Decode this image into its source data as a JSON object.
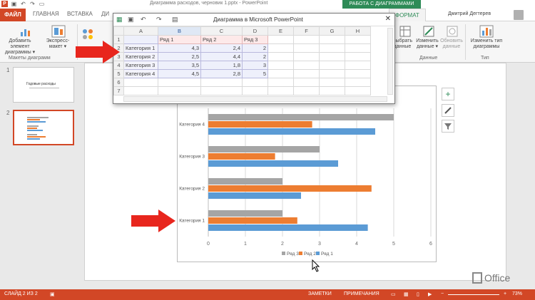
{
  "window": {
    "title": "Диаграмма расходов, черновик 1.pptx - PowerPoint",
    "context_tab": "РАБОТА С ДИАГРАММАМИ",
    "user": "Дмитрий Дегтерев"
  },
  "tabs": [
    {
      "label": "ФАЙЛ"
    },
    {
      "label": "ГЛАВНАЯ"
    },
    {
      "label": "ВСТАВКА"
    },
    {
      "label": "ДИ"
    },
    {
      "label": "ФОРМАТ"
    }
  ],
  "ribbon": {
    "add_element": "Добавить элемент диаграммы ▾",
    "express_layout": "Экспресс-макет ▾",
    "group_layouts": "Макеты диаграмм",
    "select_data": "Выбрать данные",
    "change_data": "Изменить данные ▾",
    "refresh_data": "Обновить данные",
    "group_data": "Данные",
    "change_type": "Изменить тип диаграммы",
    "group_type": "Тип"
  },
  "thumbnails": [
    {
      "num": "1",
      "title": "Годовые расходы"
    },
    {
      "num": "2"
    }
  ],
  "sheet": {
    "title": "Диаграмма в Microsoft PowerPoint",
    "columns": [
      "A",
      "B",
      "C",
      "D",
      "E",
      "F",
      "G",
      "H"
    ],
    "header_row": [
      "",
      "Ряд 1",
      "Ряд 2",
      "Ряд 3"
    ],
    "rows": [
      {
        "num": "1"
      },
      {
        "num": "2",
        "cat": "Категория 1",
        "v": [
          "4,3",
          "2,4",
          "2"
        ]
      },
      {
        "num": "3",
        "cat": "Категория 2",
        "v": [
          "2,5",
          "4,4",
          "2"
        ]
      },
      {
        "num": "4",
        "cat": "Категория 3",
        "v": [
          "3,5",
          "1,8",
          "3"
        ]
      },
      {
        "num": "5",
        "cat": "Категория 4",
        "v": [
          "4,5",
          "2,8",
          "5"
        ]
      },
      {
        "num": "6"
      },
      {
        "num": "7"
      }
    ]
  },
  "chart_data": {
    "type": "bar",
    "orientation": "horizontal",
    "categories": [
      "Категория 1",
      "Категория 2",
      "Категория 3",
      "Категория 4"
    ],
    "series": [
      {
        "name": "Ряд 1",
        "color": "#5b9bd5",
        "values": [
          4.3,
          2.5,
          3.5,
          4.5
        ]
      },
      {
        "name": "Ряд 2",
        "color": "#ed7d31",
        "values": [
          2.4,
          4.4,
          1.8,
          2.8
        ]
      },
      {
        "name": "Ряд 3",
        "color": "#a5a5a5",
        "values": [
          2,
          2,
          3,
          5
        ]
      }
    ],
    "x_ticks": [
      "0",
      "1",
      "2",
      "3",
      "4",
      "5",
      "6"
    ],
    "xlim": [
      0,
      6
    ],
    "legend": [
      "Ряд 3",
      "Ряд 2",
      "Ряд 1"
    ],
    "legend_position": "bottom",
    "grid": true
  },
  "status": {
    "slide": "СЛАЙД 2 ИЗ 2",
    "notes": "ЗАМЕТКИ",
    "comments": "ПРИМЕЧАНИЯ",
    "zoom": "73%"
  },
  "office_logo": "Office",
  "colors": {
    "accent": "#d24726",
    "context": "#2e8b57"
  }
}
